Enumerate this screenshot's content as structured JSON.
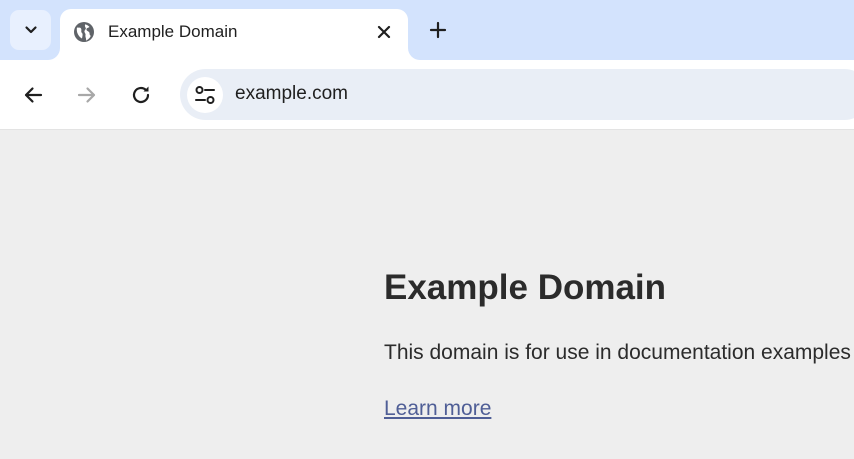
{
  "browser": {
    "tab": {
      "title": "Example Domain",
      "favicon": "globe-icon",
      "close_icon": "close-icon"
    },
    "tab_search_icon": "chevron-down-icon",
    "new_tab_icon": "plus-icon",
    "toolbar": {
      "back_icon": "arrow-left-icon",
      "forward_icon": "arrow-right-icon",
      "reload_icon": "reload-icon",
      "site_info_icon": "tune-icon",
      "url": "example.com"
    },
    "colors": {
      "tabstrip": "#d3e3fd",
      "omnibox": "#e9eef6",
      "page_background": "#eeeeee",
      "link": "#4f5e96"
    }
  },
  "page": {
    "heading": "Example Domain",
    "paragraph": "This domain is for use in documentation examples without needing permission.",
    "link_text": "Learn more"
  }
}
